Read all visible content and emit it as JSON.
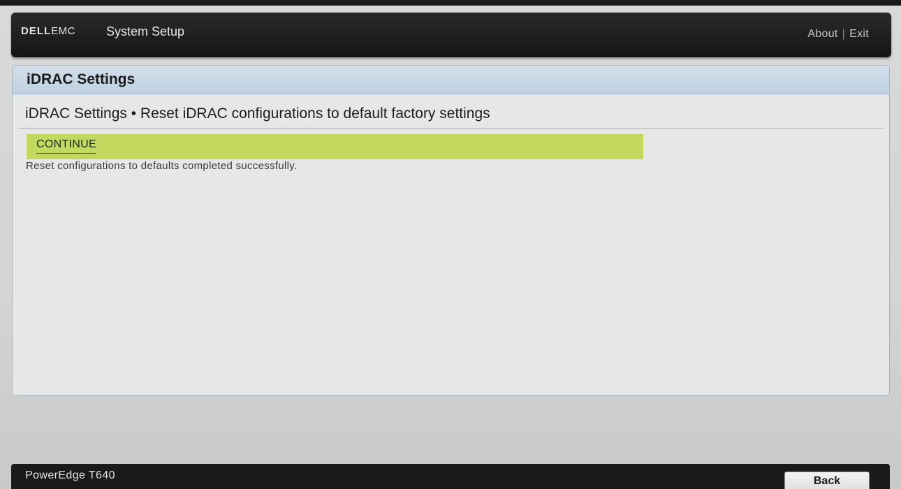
{
  "header": {
    "logo_dell": "DELL",
    "logo_emc": "EMC",
    "title": "System Setup",
    "about_label": "About",
    "separator": "|",
    "exit_label": "Exit"
  },
  "panel": {
    "title": "iDRAC Settings",
    "breadcrumb": "iDRAC Settings • Reset iDRAC configurations to default factory settings",
    "continue_label": "CONTINUE",
    "status_message": "Reset configurations to defaults completed successfully."
  },
  "footer": {
    "model": "PowerEdge T640",
    "back_label": "Back"
  },
  "colors": {
    "header_bg": "#151515",
    "panel_head_bg": "#c8d8e6",
    "highlight_row": "#c2d85e",
    "footer_bg": "#1a1a1a"
  }
}
